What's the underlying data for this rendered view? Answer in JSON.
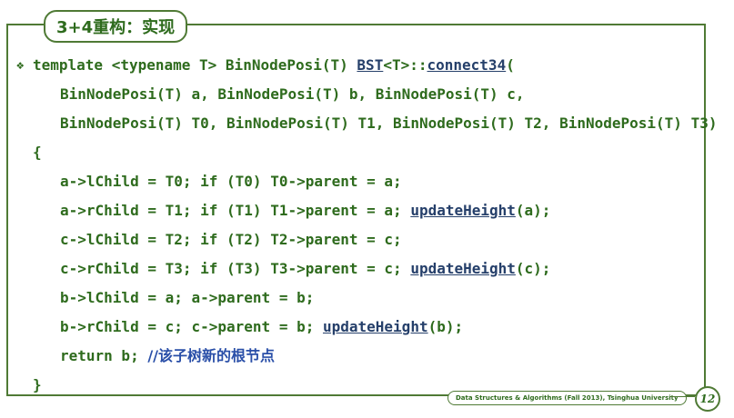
{
  "slide": {
    "title": "3+4重构：实现",
    "footer": "Data Structures & Algorithms (Fall 2013), Tsinghua University",
    "page_number": "12"
  },
  "code": {
    "l1_pre": "template <typename T> BinNodePosi(T) ",
    "l1_bst": "BST",
    "l1_mid": "<T>::",
    "l1_fn": "connect34",
    "l1_post": "(",
    "l2": "BinNodePosi(T) a, BinNodePosi(T) b, BinNodePosi(T) c,",
    "l3": "BinNodePosi(T) T0, BinNodePosi(T) T1, BinNodePosi(T) T2, BinNodePosi(T) T3)",
    "l4": "{",
    "l5": "a->lChild = T0; if (T0) T0->parent = a;",
    "l6_pre": "a->rChild = T1; if (T1) T1->parent = a; ",
    "l6_fn": "updateHeight",
    "l6_post": "(a);",
    "l7": "c->lChild = T2; if (T2) T2->parent = c;",
    "l8_pre": "c->rChild = T3; if (T3) T3->parent = c; ",
    "l8_fn": "updateHeight",
    "l8_post": "(c);",
    "l9": "b->lChild = a; a->parent = b;",
    "l10_pre": "b->rChild = c; c->parent = b; ",
    "l10_fn": "updateHeight",
    "l10_post": "(b);",
    "l11_pre": "return b; ",
    "l11_comment": "//该子树新的根节点",
    "l12": "}"
  },
  "icons": {
    "bullet": "diamond-bullet-icon"
  },
  "colors": {
    "frame": "#4f7a35",
    "code": "#2e6b1d",
    "link": "#253f6a",
    "comment": "#2a4fa8"
  }
}
